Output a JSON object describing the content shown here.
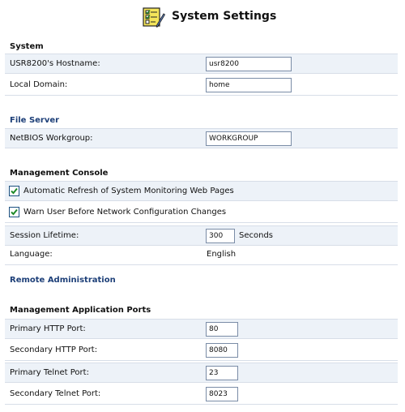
{
  "header": {
    "title": "System Settings",
    "icon": "settings-checklist-icon"
  },
  "system": {
    "heading": "System",
    "hostname_label": "USR8200's Hostname:",
    "hostname_value": "usr8200",
    "domain_label": "Local Domain:",
    "domain_value": "home"
  },
  "file_server": {
    "heading": "File Server",
    "workgroup_label": "NetBIOS Workgroup:",
    "workgroup_value": "WORKGROUP"
  },
  "management_console": {
    "heading": "Management Console",
    "auto_refresh_label": "Automatic Refresh of System Monitoring Web Pages",
    "auto_refresh_checked": true,
    "warn_user_label": "Warn User Before Network Configuration Changes",
    "warn_user_checked": true,
    "session_label": "Session Lifetime:",
    "session_value": "300",
    "session_unit": "Seconds",
    "language_label": "Language:",
    "language_value": "English"
  },
  "remote_admin": {
    "heading": "Remote Administration"
  },
  "ports": {
    "heading": "Management Application Ports",
    "primary_http_label": "Primary HTTP Port:",
    "primary_http_value": "80",
    "secondary_http_label": "Secondary HTTP Port:",
    "secondary_http_value": "8080",
    "primary_telnet_label": "Primary Telnet Port:",
    "primary_telnet_value": "23",
    "secondary_telnet_label": "Secondary Telnet Port:",
    "secondary_telnet_value": "8023"
  },
  "colors": {
    "heading_blue": "#1d3f78",
    "row_shade": "#edf2f8",
    "check_green": "#1f8a2a"
  }
}
